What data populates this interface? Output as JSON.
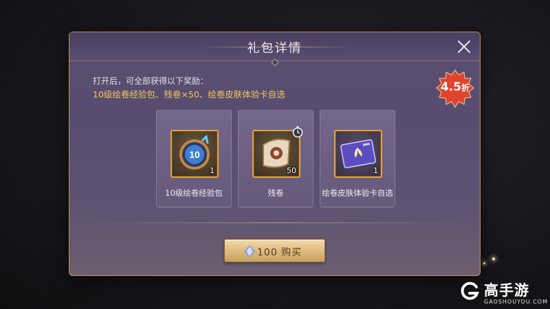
{
  "dialog": {
    "title": "礼包详情",
    "description": "打开后，可全部获得以下奖励：",
    "rewards_summary": "10级绘卷经验包、残卷×50、绘卷皮肤体验卡自选",
    "discount_badge": {
      "value": "4.5",
      "unit": "折"
    },
    "items": [
      {
        "icon": "experience-pack-icon",
        "count": "1",
        "label": "10级绘卷经验包",
        "icon_text": "10"
      },
      {
        "icon": "scroll-fragment-icon",
        "count": "50",
        "label": "残卷",
        "timed": true
      },
      {
        "icon": "skin-trial-card-icon",
        "count": "1",
        "label": "绘卷皮肤体验卡自选"
      }
    ],
    "buy_button": {
      "label": "100 购买",
      "currency_icon": "crystal-gem-icon"
    }
  },
  "watermark": {
    "brand": "高手游",
    "domain": "GAOSHOUYOU.COM"
  },
  "colors": {
    "accent_gold": "#f3c55a",
    "badge_red": "#e0432e",
    "frame_orange": "#e3a33e",
    "panel_purple": "#5a4e72"
  }
}
